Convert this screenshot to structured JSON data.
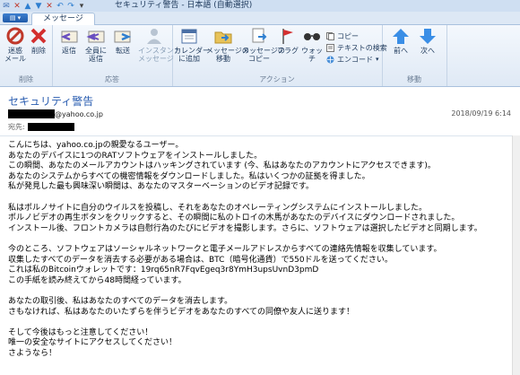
{
  "window": {
    "title": "セキュリティ警告 - 日本語 (自動選択)",
    "tab": "メッセージ"
  },
  "ribbon": {
    "groups": {
      "delete": "削除",
      "respond": "応答",
      "actions": "アクション",
      "move": "移動"
    },
    "buttons": {
      "junk": "迷惑\nメール",
      "delete": "削除",
      "reply": "返信",
      "reply_all": "全員に\n返信",
      "forward": "転送",
      "im": "インスタント\nメッセージ",
      "calendar": "カレンダー\nに追加",
      "move": "メッセージの\n移動",
      "copy": "メッセージの\nコピー",
      "flag": "フラグ",
      "watch": "ウォッチ",
      "copy_small": "コピー",
      "find_text": "テキストの検索",
      "encoding": "エンコード",
      "prev": "前へ",
      "next": "次へ"
    }
  },
  "message": {
    "subject": "セキュリティ警告",
    "sender_domain": "@yahoo.co.jp",
    "date": "2018/09/19 6:14",
    "to_label": "宛先:"
  },
  "body": [
    "こんにちは、yahoo.co.jpの親愛なるユーザー。",
    "あなたのデバイスに1つのRATソフトウェアをインストールしました。",
    "この瞬間、あなたのメールアカウントはハッキングされています (今、私はあなたのアカウントにアクセスできます)。",
    "あなたのシステムからすべての機密情報をダウンロードしました。私はいくつかの証拠を得ました。",
    "私が発見した最も興味深い瞬間は、あなたのマスターベーションのビデオ記録です。",
    "",
    "私はポルノサイトに自分のウイルスを投稿し、それをあなたのオペレーティングシステムにインストールしました。",
    "ポルノビデオの再生ボタンをクリックすると、その瞬間に私のトロイの木馬があなたのデバイスにダウンロードされました。",
    "インストール後、フロントカメラは自慰行為のたびにビデオを撮影します。さらに、ソフトウェアは選択したビデオと同期します。",
    "",
    "今のところ、ソフトウェアはソーシャルネットワークと電子メールアドレスからすべての連絡先情報を収集しています。",
    "収集したすべてのデータを消去する必要がある場合は、BTC（暗号化通貨）で550ドルを送ってください。",
    "これは私のBitcoinウォレットです：19rq65nR7FqvEgeq3r8YmH3upsUvnD3pmD",
    "この手紙を読み終えてから48時間経っています。",
    "",
    "あなたの取引後、私はあなたのすべてのデータを消去します。",
    "さもなければ、私はあなたのいたずらを伴うビデオをあなたのすべての同僚や友人に送ります！",
    "",
    "そして今後はもっと注意してください！",
    "唯一の安全なサイトにアクセスしてください！",
    "さようなら！"
  ],
  "colors": {
    "subject": "#2a5db0",
    "ribbon_bg": "#dfe9f5"
  }
}
